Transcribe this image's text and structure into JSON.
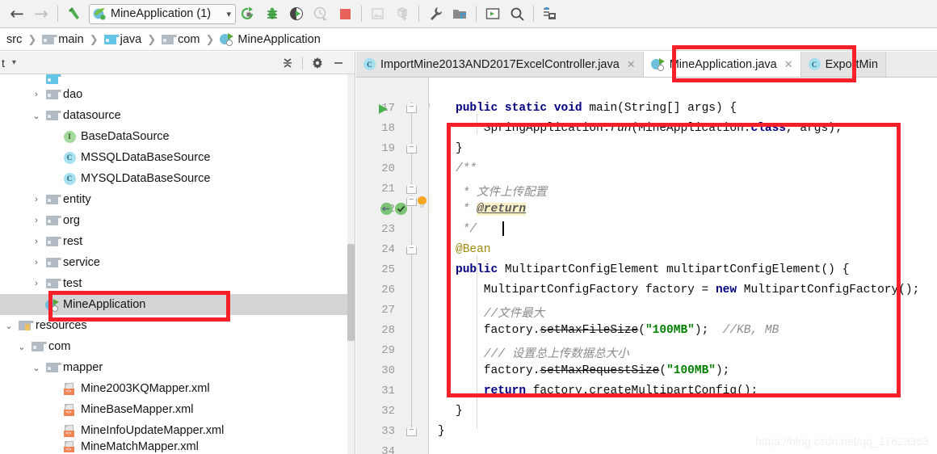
{
  "toolbar": {
    "back_label": "←",
    "forward_label": "→",
    "build_icon": "hammer-icon",
    "run_config": {
      "name": "MineApplication (1)",
      "chevron": "▾",
      "icon": "spring-boot-icon"
    },
    "buttons": [
      {
        "name": "run-button",
        "icon": "run-icon"
      },
      {
        "name": "debug-button",
        "icon": "bug-icon"
      },
      {
        "name": "run-with-coverage-button",
        "icon": "run-coverage-icon"
      },
      {
        "name": "profile-button",
        "icon": "profiler-icon"
      },
      {
        "name": "stop-button",
        "icon": "stop-square-icon"
      },
      {
        "name": "update-app-button",
        "icon": "update-app-icon"
      },
      {
        "name": "deploy-button",
        "icon": "deploy-box-icon"
      },
      {
        "name": "settings-button",
        "icon": "wrench-icon"
      },
      {
        "name": "project-structure-button",
        "icon": "project-structure-icon"
      },
      {
        "name": "terminal-button",
        "icon": "console-icon"
      },
      {
        "name": "search-everywhere-button",
        "icon": "search-icon"
      },
      {
        "name": "save-all-button",
        "icon": "save-all-icon"
      }
    ]
  },
  "breadcrumb": {
    "items": [
      {
        "label": "src",
        "icon": "none"
      },
      {
        "label": "main",
        "icon": "folder-icon"
      },
      {
        "label": "java",
        "icon": "folder-blue-icon"
      },
      {
        "label": "com",
        "icon": "folder-icon"
      },
      {
        "label": "MineApplication",
        "icon": "spring-class-icon"
      }
    ],
    "separator": "❯"
  },
  "project_panel": {
    "title": "t",
    "chevron": "▾",
    "actions": [
      {
        "name": "collapse-all-button",
        "icon": "collapse-all-icon"
      },
      {
        "name": "panel-settings-button",
        "icon": "gear-icon"
      },
      {
        "name": "hide-panel-button",
        "icon": "minimize-icon"
      }
    ],
    "tree": [
      {
        "label": "",
        "indent": 3,
        "twisty": "",
        "icon": "folder-blue-icon",
        "partial": true
      },
      {
        "label": "dao",
        "indent": 3,
        "twisty": "›",
        "icon": "folder-icon"
      },
      {
        "label": "datasource",
        "indent": 3,
        "twisty": "⌄",
        "icon": "folder-icon"
      },
      {
        "label": "BaseDataSource",
        "indent": 4,
        "twisty": "",
        "icon": "interface-icon"
      },
      {
        "label": "MSSQLDataBaseSource",
        "indent": 4,
        "twisty": "",
        "icon": "class-icon"
      },
      {
        "label": "MYSQLDataBaseSource",
        "indent": 4,
        "twisty": "",
        "icon": "class-icon"
      },
      {
        "label": "entity",
        "indent": 3,
        "twisty": "›",
        "icon": "folder-icon"
      },
      {
        "label": "org",
        "indent": 3,
        "twisty": "›",
        "icon": "folder-icon"
      },
      {
        "label": "rest",
        "indent": 3,
        "twisty": "›",
        "icon": "folder-icon"
      },
      {
        "label": "service",
        "indent": 3,
        "twisty": "›",
        "icon": "folder-icon"
      },
      {
        "label": "test",
        "indent": 3,
        "twisty": "›",
        "icon": "folder-icon"
      },
      {
        "label": "MineApplication",
        "indent": 3,
        "twisty": "",
        "icon": "spring-class-icon",
        "selected": true
      },
      {
        "label": "resources",
        "indent": 1,
        "twisty": "⌄",
        "icon": "resources-folder-icon"
      },
      {
        "label": "com",
        "indent": 2,
        "twisty": "⌄",
        "icon": "folder-icon"
      },
      {
        "label": "mapper",
        "indent": 3,
        "twisty": "⌄",
        "icon": "folder-icon"
      },
      {
        "label": "Mine2003KQMapper.xml",
        "indent": 4,
        "twisty": "",
        "icon": "xml-icon"
      },
      {
        "label": "MineBaseMapper.xml",
        "indent": 4,
        "twisty": "",
        "icon": "xml-icon"
      },
      {
        "label": "MineInfoUpdateMapper.xml",
        "indent": 4,
        "twisty": "",
        "icon": "xml-icon"
      },
      {
        "label": "MineMatchMapper.xml",
        "indent": 4,
        "twisty": "",
        "icon": "xml-icon",
        "partial": true
      }
    ]
  },
  "editor": {
    "tabs": [
      {
        "label": "ImportMine2013AND2017ExcelController.java",
        "icon": "class-icon",
        "active": false,
        "close": "✕"
      },
      {
        "label": "MineApplication.java",
        "icon": "spring-class-icon",
        "active": true,
        "close": "✕"
      },
      {
        "label": "ExportMin",
        "icon": "class-icon",
        "active": false,
        "close": ""
      }
    ],
    "first_line_number": 17,
    "last_line_number": 34,
    "highlighted_line": 23,
    "lines": [
      {
        "n": 17,
        "text": "public static void main(String[] args) {"
      },
      {
        "n": 18,
        "text": "    SpringApplication.run(MineApplication.class, args);"
      },
      {
        "n": 19,
        "text": "}"
      },
      {
        "n": 20,
        "text": "/**"
      },
      {
        "n": 21,
        "text": " * 文件上传配置"
      },
      {
        "n": 22,
        "text": " * @return"
      },
      {
        "n": 23,
        "text": " */"
      },
      {
        "n": 24,
        "text": "@Bean"
      },
      {
        "n": 25,
        "text": "public MultipartConfigElement multipartConfigElement() {"
      },
      {
        "n": 26,
        "text": "    MultipartConfigFactory factory = new MultipartConfigFactory();"
      },
      {
        "n": 27,
        "text": "    //文件最大"
      },
      {
        "n": 28,
        "text": "    factory.setMaxFileSize(\"100MB\"); //KB, MB"
      },
      {
        "n": 29,
        "text": "    /// 设置总上传数据总大小"
      },
      {
        "n": 30,
        "text": "    factory.setMaxRequestSize(\"100MB\");"
      },
      {
        "n": 31,
        "text": "    return factory.createMultipartConfig();"
      },
      {
        "n": 32,
        "text": "}"
      },
      {
        "n": 33,
        "text": "}"
      },
      {
        "n": 34,
        "text": ""
      }
    ]
  },
  "annotations": {
    "highlight_color": "#f5202a",
    "boxes": [
      {
        "name": "tab-highlight-box"
      },
      {
        "name": "tree-item-highlight-box"
      },
      {
        "name": "code-block-highlight-box"
      }
    ]
  },
  "watermark": "https://blog.csdn.net/qq_17623363"
}
